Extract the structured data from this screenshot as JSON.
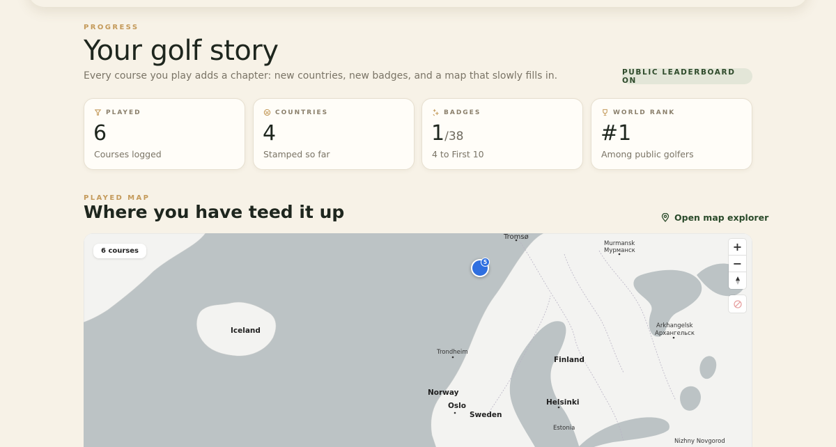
{
  "progress_eyebrow": "PROGRESS",
  "title": "Your golf story",
  "subtitle": "Every course you play adds a chapter: new countries, new badges, and a map that slowly fills in.",
  "leaderboard_pill": "PUBLIC LEADERBOARD ON",
  "stats": [
    {
      "label": "PLAYED",
      "icon": "golf-tee-icon",
      "value": "6",
      "desc": "Courses logged"
    },
    {
      "label": "COUNTRIES",
      "icon": "globe-icon",
      "value": "4",
      "desc": "Stamped so far"
    },
    {
      "label": "BADGES",
      "icon": "sparkle-icon",
      "value": "1",
      "denominator": "/38",
      "desc": "4 to First 10"
    },
    {
      "label": "WORLD RANK",
      "icon": "trophy-icon",
      "value": "#1",
      "desc": "Among public golfers"
    }
  ],
  "map_section": {
    "eyebrow": "PLAYED MAP",
    "title": "Where you have teed it up",
    "explorer_link": "Open map explorer",
    "courses_badge": "6 courses",
    "cluster_count": "5",
    "zoom_in": "+",
    "zoom_out": "−",
    "labels": {
      "tromso": "Tromsø",
      "murmansk": "Murmansk",
      "murmansk_cyr": "Мурманск",
      "iceland": "Iceland",
      "arkhangelsk": "Arkhangelsk",
      "arkhangelsk_cyr": "Архангельск",
      "trondheim": "Trondheim",
      "finland": "Finland",
      "norway": "Norway",
      "oslo": "Oslo",
      "sweden": "Sweden",
      "helsinki": "Helsinki",
      "estonia": "Estonia",
      "nizhny": "Nizhny Novgorod"
    }
  },
  "colors": {
    "background": "#f7f2e7",
    "accent_gold": "#c49a5a",
    "dark_green": "#2a4a2a",
    "cluster_blue": "#2f6fe0",
    "sea": "#bcc3c5",
    "land": "#f3f3f1"
  }
}
